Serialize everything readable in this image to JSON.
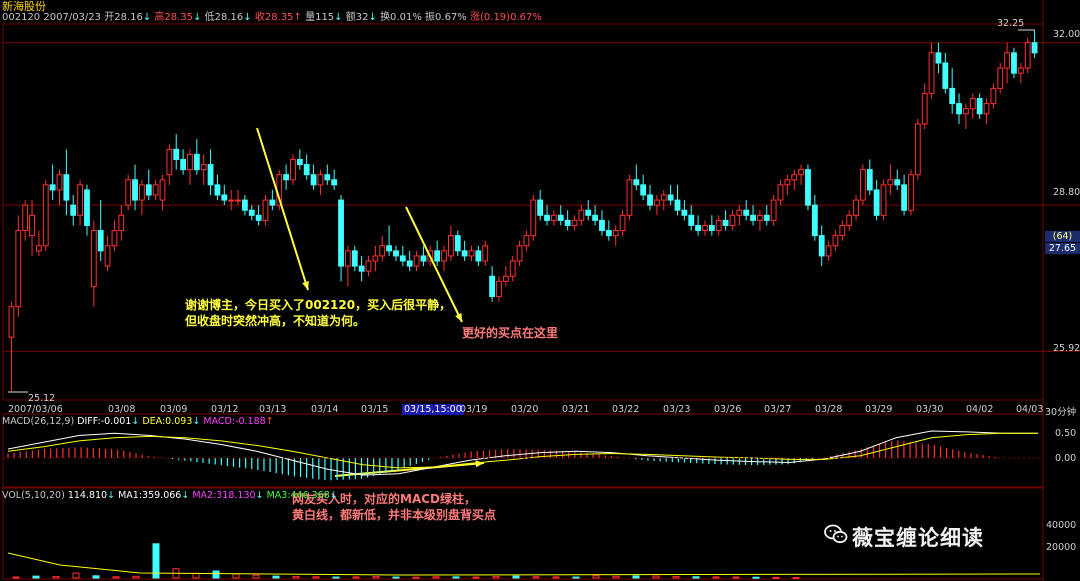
{
  "header": {
    "title": "新海股份",
    "code": "002120",
    "date": "2007/03/23",
    "open": "开28.16",
    "high": "高28.35",
    "low": "低28.16",
    "close": "收28.35",
    "volume": "量115",
    "amount": "额32",
    "turnover": "换0.01%",
    "amplitude": "振0.67%",
    "change": "涨(0.19)0.67%"
  },
  "price_axis": {
    "labels": [
      "32.00",
      "28.80",
      "25.92"
    ],
    "high_marker": "32.25",
    "low_marker": "25.12",
    "badge_count": "(64)",
    "badge_price": "27.65"
  },
  "date_axis": {
    "labels": [
      "2007/03/06",
      "03/08",
      "03/09",
      "03/12",
      "03/13",
      "03/14",
      "03/15",
      "03/15,15:00",
      "03/19",
      "03/20",
      "03/21",
      "03/22",
      "03/23",
      "03/26",
      "03/27",
      "03/28",
      "03/29",
      "03/30",
      "04/02",
      "04/03"
    ],
    "period": "30分钟"
  },
  "annotations": {
    "comment_line1": "谢谢博主，今日买入了002120，买入后很平静，",
    "comment_line2": "但收盘时突然冲高，不知道为何。",
    "better_point": "更好的买点在这里",
    "macd_note_line1": "网友买入时，对应的MACD绿柱，",
    "macd_note_line2": "黄白线，都新低，并非本级别盘背买点"
  },
  "macd_panel": {
    "name": "MACD(26,12,9)",
    "diff": "DIFF:-0.001",
    "dea": "DEA:0.093",
    "macd": "MACD:-0.188",
    "axis": [
      "0.50",
      "0.00"
    ]
  },
  "vol_panel": {
    "name": "VOL(5,10,20)",
    "vol": "114.810",
    "ma1": "MA1:359.066",
    "ma2": "MA2:318.130",
    "ma3": "MA3:446.368",
    "axis": [
      "40000",
      "20000"
    ]
  },
  "watermark": "薇宝缠论细读",
  "colors": {
    "up": "#ff3030",
    "down": "#40ffff",
    "grid": "#7a0000",
    "annotation": "#ffff40",
    "annotation_pink": "#ff7a7a",
    "diff_line": "#ffffff",
    "dea_line": "#ffff00",
    "macd_label": "#ff40ff"
  },
  "chart_data": {
    "type": "candlestick",
    "title": "新海股份",
    "y_axis_ticks": [
      32.0,
      28.8,
      25.92
    ],
    "y_range": [
      25.12,
      32.25
    ],
    "period": "30分钟",
    "candles": [
      [
        26.2,
        26.9,
        25.12,
        26.8
      ],
      [
        26.8,
        28.6,
        26.6,
        28.3
      ],
      [
        28.3,
        28.9,
        28.1,
        28.8
      ],
      [
        28.2,
        28.9,
        27.8,
        28.6
      ],
      [
        27.9,
        28.3,
        27.8,
        28.0
      ],
      [
        28.0,
        29.3,
        27.9,
        29.2
      ],
      [
        29.2,
        29.6,
        28.9,
        29.1
      ],
      [
        29.1,
        29.5,
        28.8,
        29.4
      ],
      [
        29.4,
        29.9,
        28.6,
        28.9
      ],
      [
        28.8,
        29.0,
        28.4,
        28.6
      ],
      [
        28.6,
        29.3,
        28.4,
        29.2
      ],
      [
        29.1,
        29.2,
        28.2,
        28.4
      ],
      [
        27.2,
        28.5,
        26.8,
        28.3
      ],
      [
        28.3,
        28.9,
        27.7,
        27.9
      ],
      [
        27.6,
        28.2,
        27.5,
        28.0
      ],
      [
        28.0,
        28.5,
        27.9,
        28.3
      ],
      [
        28.3,
        28.8,
        28.1,
        28.6
      ],
      [
        28.8,
        29.4,
        28.7,
        29.3
      ],
      [
        29.3,
        29.6,
        28.7,
        28.9
      ],
      [
        28.9,
        29.3,
        28.6,
        29.2
      ],
      [
        29.2,
        29.5,
        28.9,
        29.0
      ],
      [
        29.0,
        29.3,
        28.9,
        29.2
      ],
      [
        28.9,
        29.4,
        28.7,
        29.3
      ],
      [
        29.4,
        30.0,
        29.2,
        29.9
      ],
      [
        29.9,
        30.2,
        29.5,
        29.7
      ],
      [
        29.7,
        29.9,
        29.4,
        29.5
      ],
      [
        29.5,
        29.9,
        29.2,
        29.8
      ],
      [
        29.8,
        30.1,
        29.4,
        29.5
      ],
      [
        29.5,
        29.8,
        29.2,
        29.6
      ],
      [
        29.6,
        29.9,
        29.0,
        29.2
      ],
      [
        29.2,
        29.4,
        28.9,
        29.0
      ],
      [
        29.0,
        29.2,
        28.8,
        28.9
      ],
      [
        28.9,
        29.1,
        28.7,
        28.9
      ],
      [
        28.9,
        29.1,
        28.8,
        28.9
      ],
      [
        28.9,
        29.0,
        28.6,
        28.7
      ],
      [
        28.7,
        28.8,
        28.5,
        28.6
      ],
      [
        28.6,
        28.8,
        28.4,
        28.5
      ],
      [
        28.5,
        29.0,
        28.4,
        28.9
      ],
      [
        28.9,
        29.1,
        28.7,
        28.8
      ],
      [
        28.8,
        29.5,
        28.7,
        29.4
      ],
      [
        29.4,
        29.6,
        29.1,
        29.3
      ],
      [
        29.3,
        29.8,
        29.2,
        29.7
      ],
      [
        29.7,
        29.9,
        29.5,
        29.6
      ],
      [
        29.6,
        29.8,
        29.3,
        29.4
      ],
      [
        29.4,
        29.6,
        29.1,
        29.2
      ],
      [
        29.2,
        29.5,
        29.0,
        29.4
      ],
      [
        29.4,
        29.6,
        29.2,
        29.3
      ],
      [
        29.3,
        29.5,
        29.1,
        29.2
      ],
      [
        28.9,
        29.0,
        27.3,
        27.6
      ],
      [
        27.6,
        28.0,
        27.2,
        27.9
      ],
      [
        27.9,
        28.0,
        27.5,
        27.6
      ],
      [
        27.6,
        27.8,
        27.3,
        27.5
      ],
      [
        27.5,
        27.8,
        27.4,
        27.7
      ],
      [
        27.7,
        28.0,
        27.5,
        27.8
      ],
      [
        27.8,
        28.2,
        27.7,
        28.0
      ],
      [
        28.0,
        28.4,
        27.8,
        27.9
      ],
      [
        27.9,
        28.0,
        27.7,
        27.8
      ],
      [
        27.8,
        28.0,
        27.6,
        27.7
      ],
      [
        27.7,
        27.9,
        27.5,
        27.6
      ],
      [
        27.6,
        27.9,
        27.5,
        27.8
      ],
      [
        27.8,
        28.0,
        27.6,
        27.7
      ],
      [
        27.7,
        28.0,
        27.6,
        27.9
      ],
      [
        27.9,
        28.1,
        27.6,
        27.7
      ],
      [
        27.7,
        28.0,
        27.5,
        27.9
      ],
      [
        27.8,
        28.4,
        27.7,
        28.2
      ],
      [
        28.2,
        28.3,
        27.8,
        27.9
      ],
      [
        27.9,
        28.1,
        27.7,
        27.8
      ],
      [
        27.8,
        28.0,
        27.7,
        27.9
      ],
      [
        27.9,
        28.0,
        27.6,
        27.7
      ],
      [
        27.7,
        28.1,
        27.6,
        28.0
      ],
      [
        27.4,
        27.6,
        26.9,
        27.0
      ],
      [
        27.0,
        27.4,
        26.9,
        27.3
      ],
      [
        27.3,
        27.6,
        27.2,
        27.4
      ],
      [
        27.4,
        27.8,
        27.3,
        27.7
      ],
      [
        27.7,
        28.1,
        27.6,
        28.0
      ],
      [
        28.0,
        28.3,
        27.9,
        28.2
      ],
      [
        28.2,
        29.0,
        28.1,
        28.9
      ],
      [
        28.9,
        29.1,
        28.5,
        28.6
      ],
      [
        28.6,
        28.8,
        28.4,
        28.5
      ],
      [
        28.5,
        28.7,
        28.4,
        28.6
      ],
      [
        28.6,
        28.8,
        28.4,
        28.5
      ],
      [
        28.5,
        28.7,
        28.3,
        28.4
      ],
      [
        28.4,
        28.6,
        28.3,
        28.5
      ],
      [
        28.5,
        28.8,
        28.4,
        28.7
      ],
      [
        28.7,
        28.9,
        28.5,
        28.6
      ],
      [
        28.6,
        28.8,
        28.4,
        28.5
      ],
      [
        28.5,
        28.7,
        28.2,
        28.3
      ],
      [
        28.3,
        28.5,
        28.1,
        28.2
      ],
      [
        28.2,
        28.4,
        28.0,
        28.3
      ],
      [
        28.3,
        28.7,
        28.2,
        28.6
      ],
      [
        28.6,
        29.4,
        28.5,
        29.3
      ],
      [
        29.3,
        29.6,
        29.1,
        29.2
      ],
      [
        29.2,
        29.4,
        28.9,
        29.0
      ],
      [
        29.0,
        29.2,
        28.7,
        28.8
      ],
      [
        28.8,
        29.0,
        28.6,
        28.9
      ],
      [
        28.9,
        29.1,
        28.7,
        29.0
      ],
      [
        29.0,
        29.2,
        28.8,
        28.9
      ],
      [
        28.9,
        29.2,
        28.6,
        28.7
      ],
      [
        28.7,
        28.9,
        28.5,
        28.6
      ],
      [
        28.6,
        28.8,
        28.3,
        28.4
      ],
      [
        28.4,
        28.6,
        28.2,
        28.3
      ],
      [
        28.3,
        28.5,
        28.2,
        28.4
      ],
      [
        28.4,
        28.6,
        28.2,
        28.3
      ],
      [
        28.3,
        28.6,
        28.2,
        28.5
      ],
      [
        28.5,
        28.7,
        28.3,
        28.4
      ],
      [
        28.4,
        28.7,
        28.3,
        28.6
      ],
      [
        28.6,
        28.8,
        28.4,
        28.7
      ],
      [
        28.7,
        28.9,
        28.5,
        28.6
      ],
      [
        28.6,
        28.8,
        28.4,
        28.5
      ],
      [
        28.5,
        28.7,
        28.3,
        28.6
      ],
      [
        28.6,
        28.8,
        28.4,
        28.5
      ],
      [
        28.5,
        29.0,
        28.4,
        28.9
      ],
      [
        28.9,
        29.3,
        28.8,
        29.2
      ],
      [
        29.2,
        29.4,
        29.0,
        29.3
      ],
      [
        29.3,
        29.5,
        29.1,
        29.4
      ],
      [
        29.4,
        29.6,
        29.2,
        29.5
      ],
      [
        29.5,
        29.6,
        28.7,
        28.8
      ],
      [
        28.8,
        29.0,
        28.1,
        28.2
      ],
      [
        28.2,
        28.4,
        27.6,
        27.8
      ],
      [
        27.8,
        28.1,
        27.7,
        28.0
      ],
      [
        28.0,
        28.3,
        27.9,
        28.2
      ],
      [
        28.2,
        28.5,
        28.1,
        28.4
      ],
      [
        28.4,
        28.7,
        28.3,
        28.6
      ],
      [
        28.6,
        29.0,
        28.5,
        28.9
      ],
      [
        28.9,
        29.6,
        28.8,
        29.5
      ],
      [
        29.5,
        29.7,
        29.0,
        29.1
      ],
      [
        29.1,
        29.3,
        28.5,
        28.6
      ],
      [
        28.6,
        29.3,
        28.5,
        29.2
      ],
      [
        29.2,
        29.6,
        29.0,
        29.3
      ],
      [
        29.3,
        29.5,
        29.1,
        29.2
      ],
      [
        29.2,
        29.4,
        28.6,
        28.7
      ],
      [
        28.7,
        29.5,
        28.6,
        29.4
      ],
      [
        29.4,
        30.5,
        29.3,
        30.4
      ],
      [
        30.4,
        31.2,
        30.3,
        31.0
      ],
      [
        31.0,
        32.0,
        30.9,
        31.8
      ],
      [
        31.8,
        32.0,
        31.4,
        31.6
      ],
      [
        31.6,
        31.8,
        31.0,
        31.1
      ],
      [
        31.1,
        31.5,
        30.6,
        30.8
      ],
      [
        30.8,
        31.0,
        30.4,
        30.6
      ],
      [
        30.6,
        30.8,
        30.3,
        30.7
      ],
      [
        30.7,
        31.0,
        30.5,
        30.9
      ],
      [
        30.9,
        31.0,
        30.5,
        30.6
      ],
      [
        30.6,
        30.9,
        30.4,
        30.8
      ],
      [
        30.8,
        31.2,
        30.7,
        31.1
      ],
      [
        31.1,
        31.6,
        31.0,
        31.5
      ],
      [
        31.5,
        32.0,
        31.2,
        31.8
      ],
      [
        31.8,
        31.9,
        31.3,
        31.4
      ],
      [
        31.4,
        31.6,
        31.2,
        31.5
      ],
      [
        31.5,
        32.1,
        31.4,
        32.0
      ],
      [
        32.0,
        32.25,
        31.7,
        31.8
      ]
    ],
    "macd": {
      "diff": [
        0.2,
        0.35,
        0.5,
        0.55,
        0.5,
        0.42,
        0.3,
        0.15,
        -0.05,
        -0.25,
        -0.38,
        -0.35,
        -0.2,
        -0.05,
        0.05,
        0.12,
        0.15,
        0.12,
        0.05,
        0.0,
        -0.05,
        -0.08,
        -0.1,
        -0.02,
        0.15,
        0.45,
        0.6,
        0.58,
        0.55,
        0.55
      ],
      "dea": [
        0.15,
        0.25,
        0.38,
        0.45,
        0.48,
        0.45,
        0.38,
        0.28,
        0.15,
        0.0,
        -0.15,
        -0.22,
        -0.2,
        -0.12,
        -0.05,
        0.03,
        0.08,
        0.1,
        0.08,
        0.05,
        0.02,
        0.0,
        -0.03,
        -0.03,
        0.05,
        0.25,
        0.45,
        0.52,
        0.55,
        0.55
      ]
    },
    "volume": [
      600,
      1200,
      900,
      3200,
      1400,
      800,
      1100,
      22000,
      6000,
      3000,
      4500,
      2500,
      1800,
      1200,
      900,
      800,
      600,
      700,
      900,
      600,
      500,
      800,
      700,
      600,
      900,
      1200,
      800,
      700,
      600,
      1400,
      1100,
      1300,
      1200,
      900,
      800,
      700,
      600,
      500,
      400,
      300
    ]
  }
}
